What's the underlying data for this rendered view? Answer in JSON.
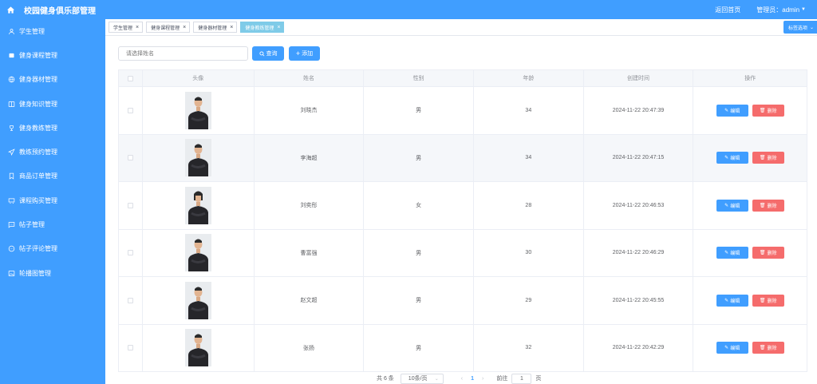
{
  "app": {
    "title": "校园健身俱乐部管理",
    "back_home": "返回首页",
    "admin": "管理员：admin"
  },
  "sidebar": {
    "items": [
      {
        "label": "学生管理",
        "icon": "user-icon"
      },
      {
        "label": "健身课程管理",
        "icon": "card-icon"
      },
      {
        "label": "健身器材管理",
        "icon": "globe-icon"
      },
      {
        "label": "健身知识管理",
        "icon": "book-icon"
      },
      {
        "label": "健身教练管理",
        "icon": "trophy-icon"
      },
      {
        "label": "教练预约管理",
        "icon": "send-icon"
      },
      {
        "label": "商品订单管理",
        "icon": "bookmark-icon"
      },
      {
        "label": "课程购买管理",
        "icon": "cart-icon"
      },
      {
        "label": "帖子管理",
        "icon": "message-icon"
      },
      {
        "label": "帖子评论管理",
        "icon": "chat-icon"
      },
      {
        "label": "轮播图管理",
        "icon": "picture-icon"
      }
    ]
  },
  "tabs": [
    {
      "label": "学生管理",
      "close": "×",
      "active": false
    },
    {
      "label": "健身课程管理",
      "close": "×",
      "active": false
    },
    {
      "label": "健身器材管理",
      "close": "×",
      "active": false
    },
    {
      "label": "健身教练管理",
      "close": "×",
      "active": true
    }
  ],
  "tag_options": "标签选项",
  "toolbar": {
    "search_placeholder": "请选择姓名",
    "query_label": "查询",
    "add_label": "添加"
  },
  "table": {
    "headers": [
      "",
      "头像",
      "姓名",
      "性别",
      "年龄",
      "创建时间",
      "操作"
    ],
    "rows": [
      {
        "name": "刘晓杰",
        "gender": "男",
        "age": "34",
        "created": "2024-11-22 20:47:39",
        "photo": "male"
      },
      {
        "name": "李海超",
        "gender": "男",
        "age": "34",
        "created": "2024-11-22 20:47:15",
        "photo": "male"
      },
      {
        "name": "刘奕彤",
        "gender": "女",
        "age": "28",
        "created": "2024-11-22 20:46:53",
        "photo": "female"
      },
      {
        "name": "曹富强",
        "gender": "男",
        "age": "30",
        "created": "2024-11-22 20:46:29",
        "photo": "male"
      },
      {
        "name": "赵文超",
        "gender": "男",
        "age": "29",
        "created": "2024-11-22 20:45:55",
        "photo": "male"
      },
      {
        "name": "张扬",
        "gender": "男",
        "age": "32",
        "created": "2024-11-22 20:42:29",
        "photo": "male"
      }
    ],
    "edit_label": "编辑",
    "delete_label": "删除"
  },
  "pagination": {
    "total": "共 6 条",
    "page_size": "10条/页",
    "current_page": "1",
    "goto_prefix": "前往",
    "goto_value": "1",
    "goto_suffix": "页"
  },
  "colors": {
    "primary": "#409eff",
    "danger": "#f56c6c",
    "active_tab": "#7fcbe8"
  }
}
